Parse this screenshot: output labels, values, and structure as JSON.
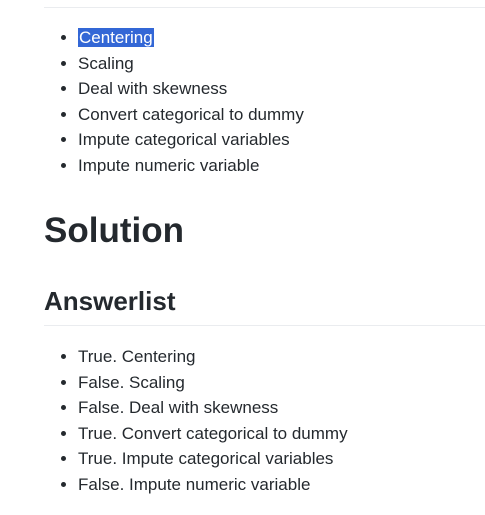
{
  "options": [
    "Centering",
    "Scaling",
    "Deal with skewness",
    "Convert categorical to dummy",
    "Impute categorical variables",
    "Impute numeric variable"
  ],
  "solution_heading": "Solution",
  "answerlist_heading": "Answerlist",
  "answers": [
    "True. Centering",
    "False. Scaling",
    "False. Deal with skewness",
    "True. Convert categorical to dummy",
    "True. Impute categorical variables",
    "False. Impute numeric variable"
  ],
  "selected_text_color": "#ffffff",
  "selection_color": "#3367d6"
}
